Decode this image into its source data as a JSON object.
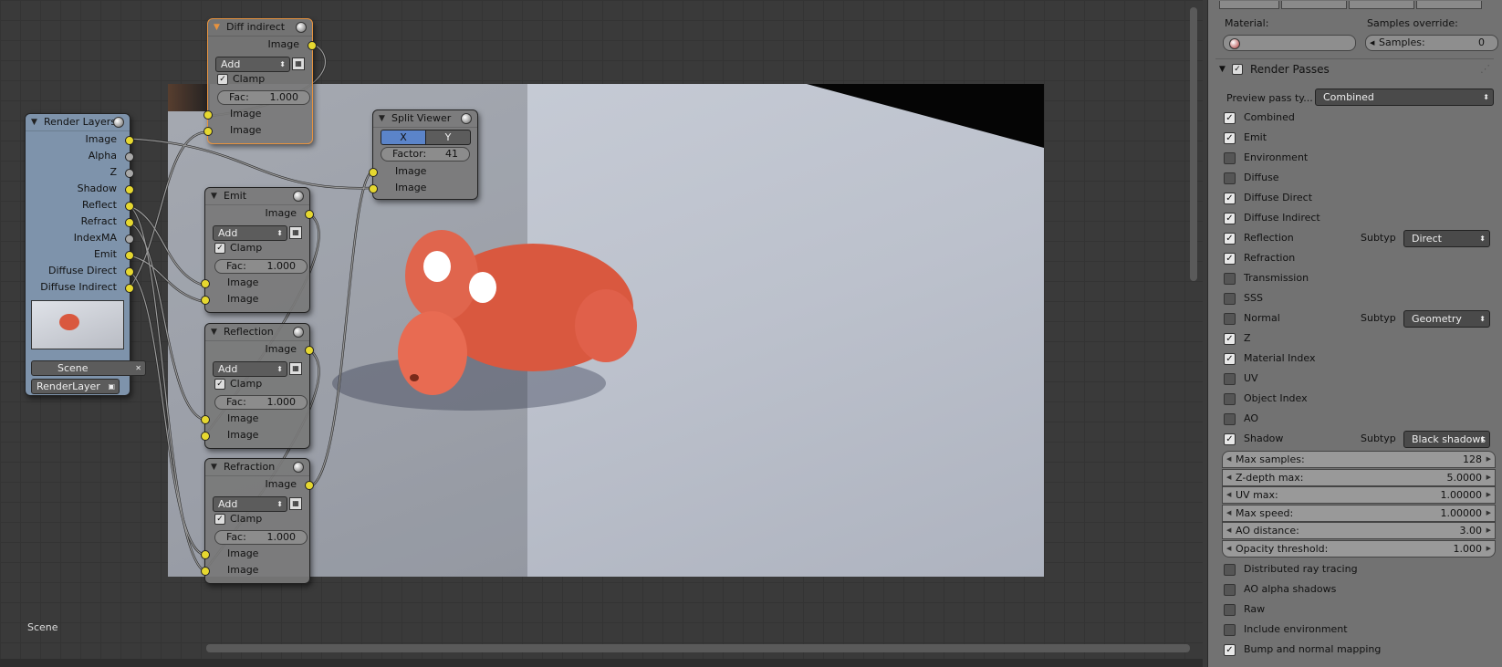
{
  "editor": {
    "scene_label": "Scene"
  },
  "render_layers_node": {
    "title": "Render Layers",
    "outputs": [
      "Image",
      "Alpha",
      "Z",
      "Shadow",
      "Reflect",
      "Refract",
      "IndexMA",
      "Emit",
      "Diffuse Direct",
      "Diffuse Indirect"
    ],
    "scene": "Scene",
    "layer": "RenderLayer"
  },
  "diff_indirect_node": {
    "title": "Diff indirect",
    "output": "Image",
    "blend": "Add",
    "clamp": "Clamp",
    "fac_label": "Fac:",
    "fac_value": "1.000",
    "in1": "Image",
    "in2": "Image"
  },
  "emit_node": {
    "title": "Emit",
    "output": "Image",
    "blend": "Add",
    "clamp": "Clamp",
    "fac_label": "Fac:",
    "fac_value": "1.000",
    "in1": "Image",
    "in2": "Image"
  },
  "reflection_node": {
    "title": "Reflection",
    "output": "Image",
    "blend": "Add",
    "clamp": "Clamp",
    "fac_label": "Fac:",
    "fac_value": "1.000",
    "in1": "Image",
    "in2": "Image"
  },
  "refraction_node": {
    "title": "Refraction",
    "output": "Image",
    "blend": "Add",
    "clamp": "Clamp",
    "fac_label": "Fac:",
    "fac_value": "1.000",
    "in1": "Image",
    "in2": "Image"
  },
  "split_viewer_node": {
    "title": "Split Viewer",
    "axis_x": "X",
    "axis_y": "Y",
    "factor_label": "Factor:",
    "factor_value": "41",
    "in1": "Image",
    "in2": "Image"
  },
  "properties": {
    "material_label": "Material:",
    "samples_override_label": "Samples override:",
    "samples_label": "Samples:",
    "samples_value": "0",
    "panel_title": "Render Passes",
    "preview_pass_label": "Preview pass ty...",
    "preview_pass_value": "Combined",
    "subtype_label": "Subtyp",
    "passes": [
      {
        "label": "Combined",
        "checked": true
      },
      {
        "label": "Emit",
        "checked": true
      },
      {
        "label": "Environment",
        "checked": false
      },
      {
        "label": "Diffuse",
        "checked": false
      },
      {
        "label": "Diffuse Direct",
        "checked": true
      },
      {
        "label": "Diffuse Indirect",
        "checked": true
      },
      {
        "label": "Reflection",
        "checked": true,
        "subtype": "Direct"
      },
      {
        "label": "Refraction",
        "checked": true
      },
      {
        "label": "Transmission",
        "checked": false
      },
      {
        "label": "SSS",
        "checked": false
      },
      {
        "label": "Normal",
        "checked": false,
        "subtype": "Geometry"
      },
      {
        "label": "Z",
        "checked": true
      },
      {
        "label": "Material Index",
        "checked": true
      },
      {
        "label": "UV",
        "checked": false
      },
      {
        "label": "Object Index",
        "checked": false
      },
      {
        "label": "AO",
        "checked": false
      },
      {
        "label": "Shadow",
        "checked": true,
        "subtype": "Black shadows"
      }
    ],
    "numeric": [
      {
        "label": "Max samples:",
        "value": "128"
      },
      {
        "label": "Z-depth max:",
        "value": "5.0000"
      },
      {
        "label": "UV max:",
        "value": "1.00000"
      },
      {
        "label": "Max speed:",
        "value": "1.00000"
      },
      {
        "label": "AO distance:",
        "value": "3.00"
      },
      {
        "label": "Opacity threshold:",
        "value": "1.000"
      }
    ],
    "options": [
      {
        "label": "Distributed ray tracing",
        "checked": false
      },
      {
        "label": "AO alpha shadows",
        "checked": false
      },
      {
        "label": "Raw",
        "checked": false
      },
      {
        "label": "Include environment",
        "checked": false
      },
      {
        "label": "Bump and normal mapping",
        "checked": true
      }
    ]
  },
  "colors": {
    "socket_yellow": "#e6d830",
    "selected_node_border": "#e8933e",
    "render_layers_bg": "#7e93ab",
    "monkey": "#e0604a"
  }
}
